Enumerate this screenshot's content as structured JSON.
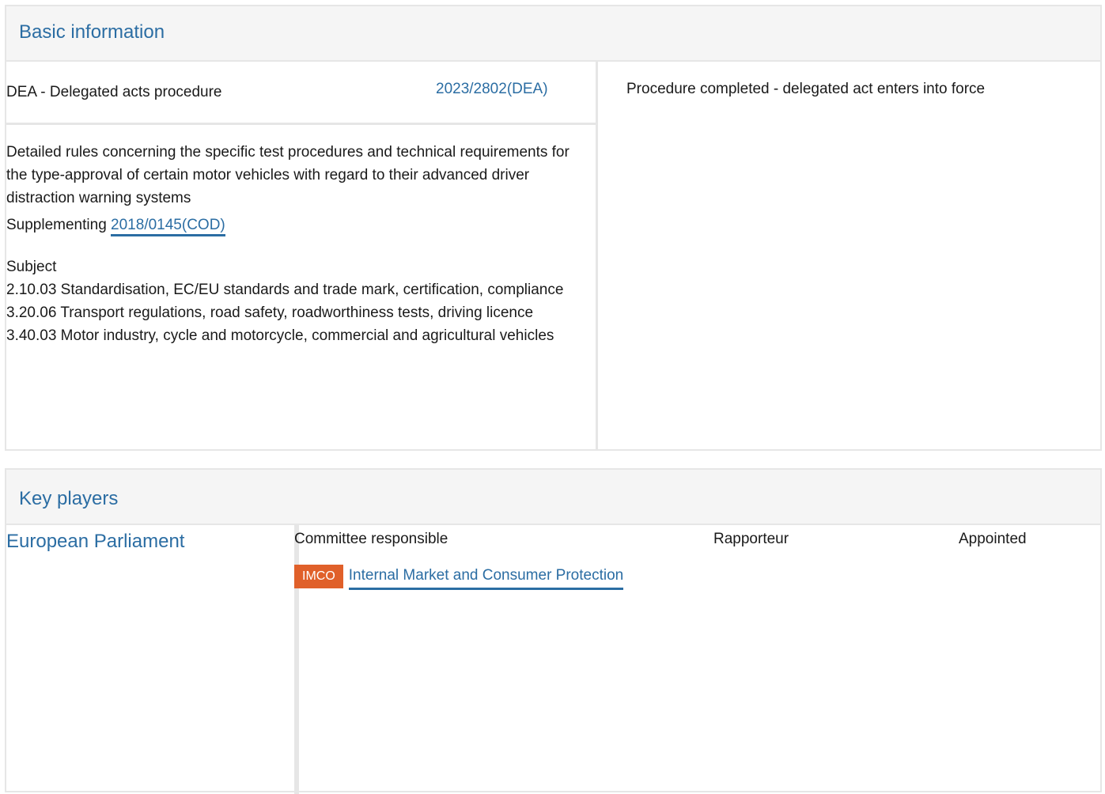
{
  "basic_info": {
    "title": "Basic information",
    "procedure_type": "DEA - Delegated acts procedure",
    "procedure_ref": "2023/2802(DEA)",
    "status": "Procedure completed - delegated act enters into force",
    "description": "Detailed rules concerning the specific test procedures and technical requirements for the type-approval of certain motor vehicles with regard to their advanced driver distraction warning systems",
    "supplementing_label": "Supplementing",
    "supplementing_ref": "2018/0145(COD)",
    "subject_label": "Subject",
    "subjects": [
      "2.10.03 Standardisation, EC/EU standards and trade mark, certification, compliance",
      "3.20.06 Transport regulations, road safety, roadworthiness tests, driving licence",
      "3.40.03 Motor industry, cycle and motorcycle, commercial and agricultural vehicles"
    ]
  },
  "key_players": {
    "title": "Key players",
    "institution": "European Parliament",
    "columns": {
      "committee": "Committee responsible",
      "rapporteur": "Rapporteur",
      "appointed": "Appointed"
    },
    "committee_badge": "IMCO",
    "committee_name": "Internal Market and Consumer Protection"
  },
  "colors": {
    "link": "#2b6da3",
    "badge": "#e0602a",
    "border": "#e6e6e6",
    "header_bg": "#f5f5f5"
  }
}
